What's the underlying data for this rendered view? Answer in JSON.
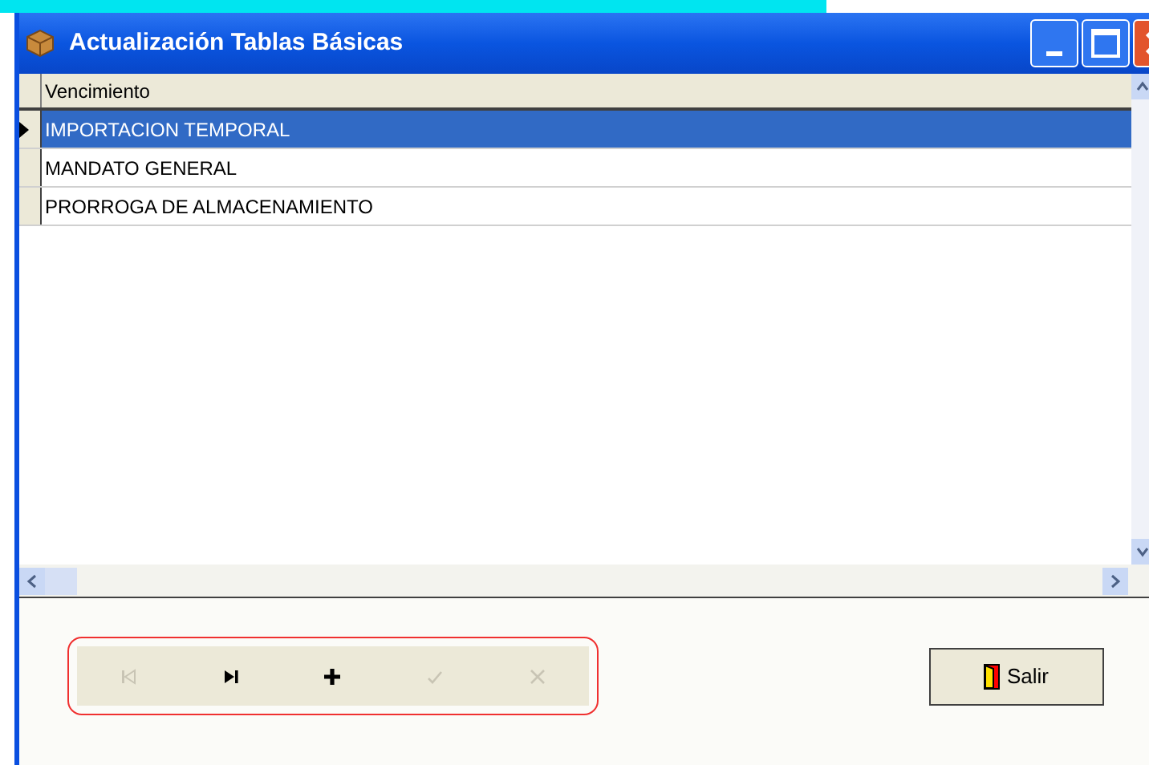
{
  "window": {
    "title": "Actualización Tablas Básicas"
  },
  "grid": {
    "columns": [
      "Vencimiento"
    ],
    "rows": [
      {
        "cells": [
          "IMPORTACION TEMPORAL"
        ],
        "selected": true
      },
      {
        "cells": [
          "MANDATO GENERAL"
        ],
        "selected": false
      },
      {
        "cells": [
          "PRORROGA DE ALMACENAMIENTO"
        ],
        "selected": false
      }
    ]
  },
  "navigator": {
    "buttons": [
      {
        "kind": "first",
        "disabled": true
      },
      {
        "kind": "last",
        "disabled": false
      },
      {
        "kind": "insert",
        "disabled": false
      },
      {
        "kind": "post",
        "disabled": true
      },
      {
        "kind": "cancel",
        "disabled": true
      }
    ]
  },
  "exit_button": {
    "label": "Salir"
  }
}
